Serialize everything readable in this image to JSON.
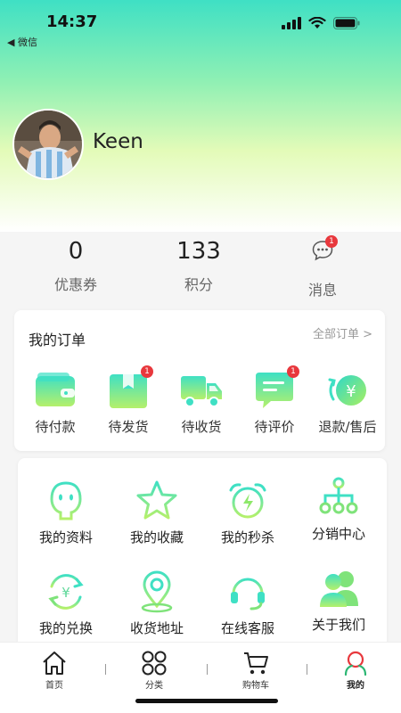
{
  "status_bar": {
    "time": "14:37",
    "back_app": "◀ 微信"
  },
  "profile": {
    "username": "Keen"
  },
  "stats": [
    {
      "value": "0",
      "label": "优惠券"
    },
    {
      "value": "133",
      "label": "积分"
    },
    {
      "label": "消息",
      "badge": "1",
      "icon": "message-bubble-icon"
    }
  ],
  "orders": {
    "title": "我的订单",
    "all_label": "全部订单 >",
    "items": [
      {
        "label": "待付款",
        "icon": "wallet-icon"
      },
      {
        "label": "待发货",
        "icon": "package-icon",
        "badge": "1"
      },
      {
        "label": "待收货",
        "icon": "truck-icon"
      },
      {
        "label": "待评价",
        "icon": "comment-icon",
        "badge": "1"
      },
      {
        "label": "退款/售后",
        "icon": "refund-icon"
      }
    ]
  },
  "services": [
    {
      "label": "我的资料",
      "icon": "profile-icon"
    },
    {
      "label": "我的收藏",
      "icon": "star-icon"
    },
    {
      "label": "我的秒杀",
      "icon": "alarm-clock-icon"
    },
    {
      "label": "分销中心",
      "icon": "hierarchy-icon"
    },
    {
      "label": "我的兑换",
      "icon": "exchange-icon"
    },
    {
      "label": "收货地址",
      "icon": "location-icon"
    },
    {
      "label": "在线客服",
      "icon": "headset-icon"
    },
    {
      "label": "关于我们",
      "icon": "people-icon"
    }
  ],
  "tabbar": [
    {
      "label": "首页",
      "icon": "home-icon"
    },
    {
      "label": "分类",
      "icon": "category-icon"
    },
    {
      "label": "购物车",
      "icon": "cart-icon"
    },
    {
      "label": "我的",
      "icon": "user-icon",
      "active": true
    }
  ],
  "colors": {
    "accent_start": "#3fe0c4",
    "accent_end": "#a6f06a",
    "badge": "#e8383d",
    "active_tab": "#e8383d"
  }
}
